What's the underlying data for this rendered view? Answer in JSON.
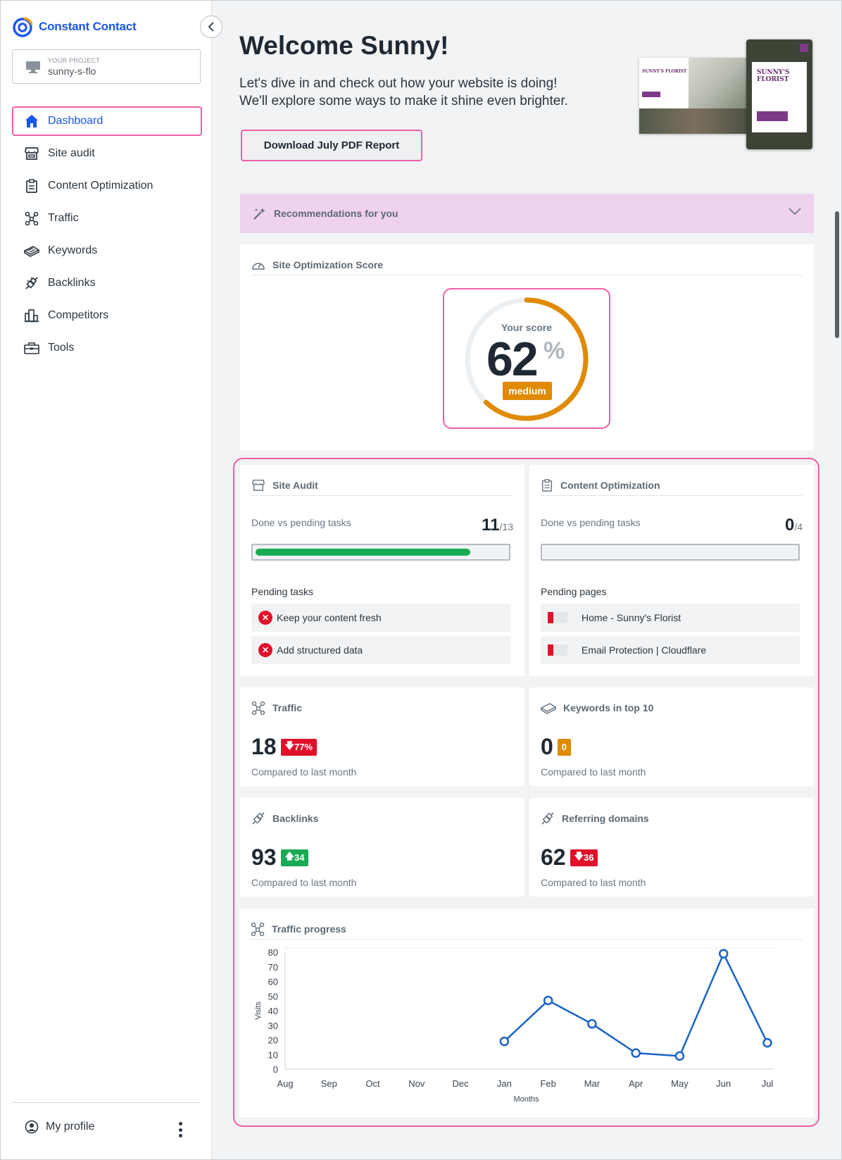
{
  "app": {
    "brand": "Constant Contact",
    "accent": "#1856ed",
    "highlight": "#ef5fa7"
  },
  "project": {
    "label": "YOUR PROJECT",
    "value": "sunny-s-flo"
  },
  "nav": [
    {
      "label": "Dashboard",
      "icon": "home-icon",
      "active": true
    },
    {
      "label": "Site audit",
      "icon": "storefront-icon"
    },
    {
      "label": "Content Optimization",
      "icon": "clipboard-icon"
    },
    {
      "label": "Traffic",
      "icon": "network-icon"
    },
    {
      "label": "Keywords",
      "icon": "keyboard-icon"
    },
    {
      "label": "Backlinks",
      "icon": "plug-icon"
    },
    {
      "label": "Competitors",
      "icon": "buildings-icon"
    },
    {
      "label": "Tools",
      "icon": "toolbox-icon"
    }
  ],
  "profile": {
    "label": "My profile"
  },
  "welcome": {
    "title": "Welcome Sunny!",
    "line1": "Let's dive in and check out how your website is doing!",
    "line2": "We'll explore some ways to make it shine even brighter.",
    "pdf_button": "Download July PDF Report"
  },
  "hero": {
    "desktop_title": "SUNNY'S FLORIST",
    "phone_title_1": "SUNNY'S",
    "phone_title_2": "FLORIST"
  },
  "recommendations": {
    "label": "Recommendations for you"
  },
  "score": {
    "title": "Site Optimization Score",
    "label": "Your score",
    "value": "62",
    "unit": "%",
    "fraction": 0.62,
    "rating": "medium",
    "color": "#e08a00"
  },
  "site_audit": {
    "title": "Site Audit",
    "subtitle": "Done vs pending tasks",
    "done": "11",
    "total": "/13",
    "progress": 0.846,
    "pending_label": "Pending tasks",
    "pending": [
      "Keep your content fresh",
      "Add structured data"
    ]
  },
  "content_optimization": {
    "title": "Content Optimization",
    "subtitle": "Done vs pending tasks",
    "done": "0",
    "total": "/4",
    "progress": 0,
    "pending_label": "Pending pages",
    "pending": [
      "Home - Sunny's Florist",
      "Email Protection | Cloudflare"
    ]
  },
  "stats": {
    "traffic": {
      "title": "Traffic",
      "value": "18",
      "delta": "77%",
      "direction": "down",
      "compare": "Compared to last month"
    },
    "keywords": {
      "title": "Keywords in top 10",
      "value": "0",
      "delta": "0",
      "direction": "neutral",
      "compare": "Compared to last month"
    },
    "backlinks": {
      "title": "Backlinks",
      "value": "93",
      "delta": "34",
      "direction": "up",
      "compare": "Compared to last month"
    },
    "referring": {
      "title": "Referring domains",
      "value": "62",
      "delta": "36",
      "direction": "down",
      "compare": "Compared to last month"
    }
  },
  "traffic_progress": {
    "title": "Traffic progress"
  },
  "chart_data": {
    "type": "line",
    "categories": [
      "Aug",
      "Sep",
      "Oct",
      "Nov",
      "Dec",
      "Jan",
      "Feb",
      "Mar",
      "Apr",
      "May",
      "Jun",
      "Jul"
    ],
    "series": [
      {
        "values": [
          null,
          null,
          null,
          null,
          null,
          19,
          47,
          31,
          11,
          9,
          79,
          18
        ]
      }
    ],
    "xlabel": "Months",
    "ylabel": "Visits",
    "ylim": [
      0,
      80
    ],
    "yticks": [
      0,
      10,
      20,
      30,
      40,
      50,
      60,
      70,
      80
    ],
    "line_color": "#1a63c6",
    "grid": false
  }
}
